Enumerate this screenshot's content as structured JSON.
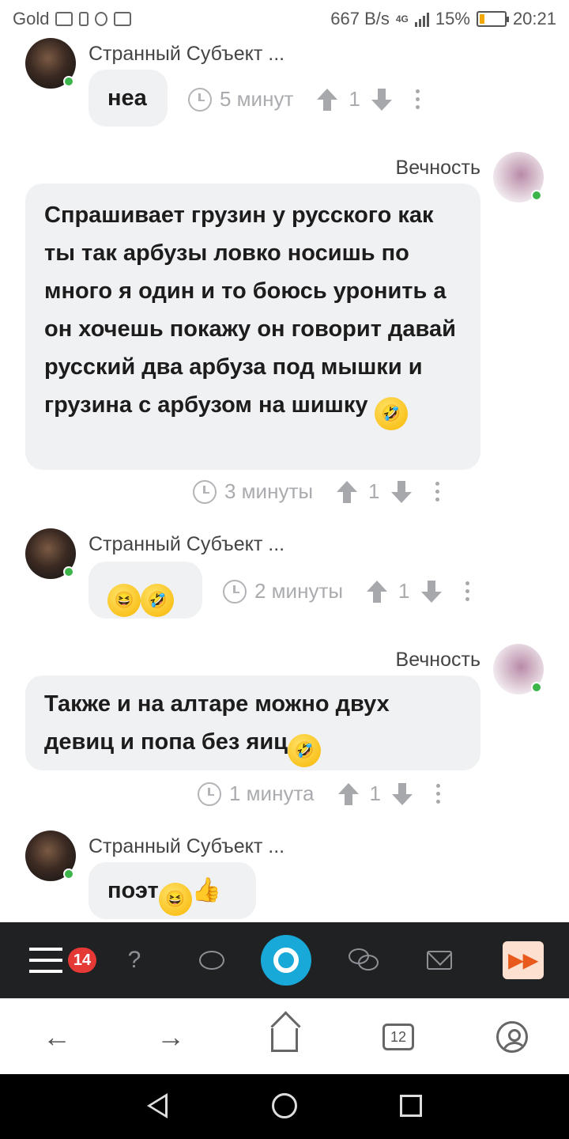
{
  "status_bar": {
    "carrier": "Gold",
    "speed": "667 B/s",
    "network": "4G",
    "battery_percent": "15%",
    "time": "20:21"
  },
  "messages": [
    {
      "author": "Странный Субъект ...",
      "text": "неа",
      "time": "5 минут",
      "votes": "1"
    },
    {
      "author": "Вечность",
      "text": "Спрашивает грузин у русского как ты так арбузы ловко носишь по много я один и то боюсь уронить а он хочешь покажу он говорит давай русский два арбуза под мышки и грузина с арбузом на шишку",
      "time": "3 минуты",
      "votes": "1"
    },
    {
      "author": "Странный Субъект ...",
      "text": "",
      "time": "2 минуты",
      "votes": "1"
    },
    {
      "author": "Вечность",
      "text": "Также и на алтаре можно двух девиц и попа без яиц",
      "time": "1 минута",
      "votes": "1"
    },
    {
      "author": "Странный Субъект ...",
      "text": "поэт",
      "time": "",
      "votes": ""
    }
  ],
  "app_nav": {
    "notifications_badge": "14",
    "help_glyph": "?",
    "accent_color": "#18a9d8"
  },
  "browser_nav": {
    "tabs_count": "12"
  },
  "icons": [
    "menu-icon",
    "help-icon",
    "chat-icon",
    "discussions-icon",
    "mail-icon",
    "fast-forward-icon",
    "back-arrow-icon",
    "forward-arrow-icon",
    "home-icon",
    "tabs-icon",
    "profile-icon"
  ]
}
